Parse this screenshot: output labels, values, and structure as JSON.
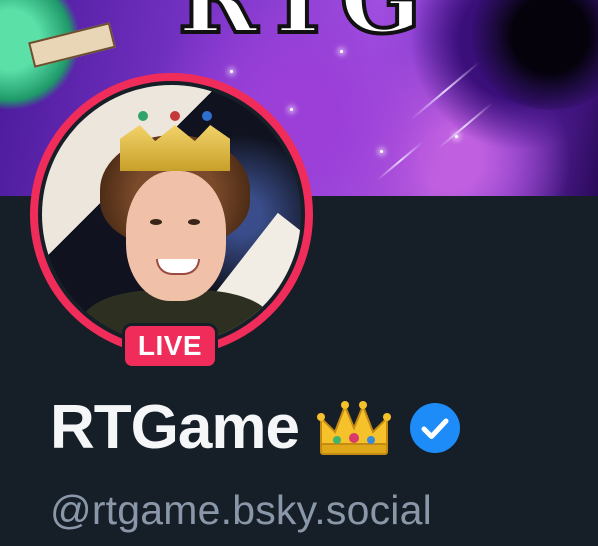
{
  "profile": {
    "display_name": "RTGame",
    "handle": "@rtgame.bsky.social",
    "live_label": "LIVE",
    "name_emoji": "crown-emoji",
    "verified_icon": "verified-check-icon"
  },
  "banner": {
    "word": "RTG"
  },
  "colors": {
    "background": "#161e27",
    "live_accent": "#f02d5a",
    "display_name": "#f4f6f8",
    "handle": "#8a97a8",
    "verified_blue": "#1d8cf8"
  }
}
